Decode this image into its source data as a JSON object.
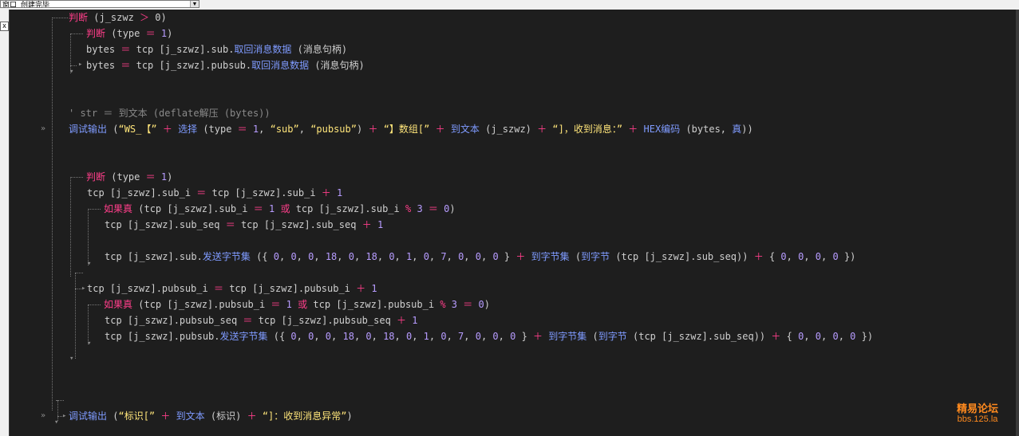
{
  "window": {
    "title_combo_text": "窗口_创建完毕"
  },
  "close_glyph": "x",
  "colors": {
    "background": "#1e1e1e",
    "keyword": "#ff3e8a",
    "function": "#7f9bff",
    "number": "#b79cff",
    "string": "#ffe57a",
    "comment": "#8a8a8a",
    "text": "#cfcfcf"
  },
  "code": {
    "l1": [
      "判断",
      " (j_szwz ",
      "＞",
      " 0)"
    ],
    "l2": [
      "判断",
      " (type ",
      "＝",
      " ",
      "1",
      ")"
    ],
    "l3": [
      "bytes ",
      "＝",
      " tcp [j_szwz].sub.",
      "取回消息数据",
      " (消息句柄)"
    ],
    "l4": [
      "bytes ",
      "＝",
      " tcp [j_szwz].pubsub.",
      "取回消息数据",
      " (消息句柄)"
    ],
    "l5": [
      "' str ＝ 到文本 (deflate解压 (bytes))"
    ],
    "l6": [
      "调试输出",
      " (",
      "“WS_【”",
      " ",
      "＋",
      " ",
      "选择",
      " (type ",
      "＝",
      " ",
      "1",
      ", ",
      "“sub”",
      ", ",
      "“pubsub”",
      ") ",
      "＋",
      " ",
      "“】数组[”",
      " ",
      "＋",
      " ",
      "到文本",
      " (j_szwz) ",
      "＋",
      " ",
      "“]，收到消息：”",
      " ",
      "＋",
      " ",
      "HEX编码",
      " (bytes, ",
      "真",
      "))"
    ],
    "l7": [
      "判断",
      " (type ",
      "＝",
      " ",
      "1",
      ")"
    ],
    "l8": [
      "tcp [j_szwz].sub_i ",
      "＝",
      " tcp [j_szwz].sub_i ",
      "＋",
      " ",
      "1"
    ],
    "l9": [
      "如果真",
      " (tcp [j_szwz].sub_i ",
      "＝",
      " ",
      "1",
      " ",
      "或",
      " tcp [j_szwz].sub_i ",
      "%",
      " ",
      "3",
      " ",
      "＝",
      " ",
      "0",
      ")"
    ],
    "l10": [
      "tcp [j_szwz].sub_seq ",
      "＝",
      " tcp [j_szwz].sub_seq ",
      "＋",
      " ",
      "1"
    ],
    "l11": [
      "tcp [j_szwz].sub.",
      "发送字节集",
      " ({ ",
      "0",
      ", ",
      "0",
      ", ",
      "0",
      ", ",
      "18",
      ", ",
      "0",
      ", ",
      "18",
      ", ",
      "0",
      ", ",
      "1",
      ", ",
      "0",
      ", ",
      "7",
      ", ",
      "0",
      ", ",
      "0",
      ", ",
      "0",
      " } ",
      "＋",
      " ",
      "到字节集",
      " (",
      "到字节",
      " (tcp [j_szwz].sub_seq)) ",
      "＋",
      " { ",
      "0",
      ", ",
      "0",
      ", ",
      "0",
      ", ",
      "0",
      " })"
    ],
    "l12": [
      "tcp [j_szwz].pubsub_i ",
      "＝",
      " tcp [j_szwz].pubsub_i ",
      "＋",
      " ",
      "1"
    ],
    "l13": [
      "如果真",
      " (tcp [j_szwz].pubsub_i ",
      "＝",
      " ",
      "1",
      " ",
      "或",
      " tcp [j_szwz].pubsub_i ",
      "%",
      " ",
      "3",
      " ",
      "＝",
      " ",
      "0",
      ")"
    ],
    "l14": [
      "tcp [j_szwz].pubsub_seq ",
      "＝",
      " tcp [j_szwz].pubsub_seq ",
      "＋",
      " ",
      "1"
    ],
    "l15": [
      "tcp [j_szwz].pubsub.",
      "发送字节集",
      " ({ ",
      "0",
      ", ",
      "0",
      ", ",
      "0",
      ", ",
      "18",
      ", ",
      "0",
      ", ",
      "18",
      ", ",
      "0",
      ", ",
      "1",
      ", ",
      "0",
      ", ",
      "7",
      ", ",
      "0",
      ", ",
      "0",
      ", ",
      "0",
      " } ",
      "＋",
      " ",
      "到字节集",
      " (",
      "到字节",
      " (tcp [j_szwz].sub_seq)) ",
      "＋",
      " { ",
      "0",
      ", ",
      "0",
      ", ",
      "0",
      ", ",
      "0",
      " })"
    ],
    "l16": [
      "调试输出",
      " (",
      "“标识[”",
      " ",
      "＋",
      " ",
      "到文本",
      " (标识) ",
      "＋",
      " ",
      "“]：收到消息异常”",
      ")"
    ]
  },
  "watermark": {
    "line1": "精易论坛",
    "line2": "bbs.125.la"
  }
}
